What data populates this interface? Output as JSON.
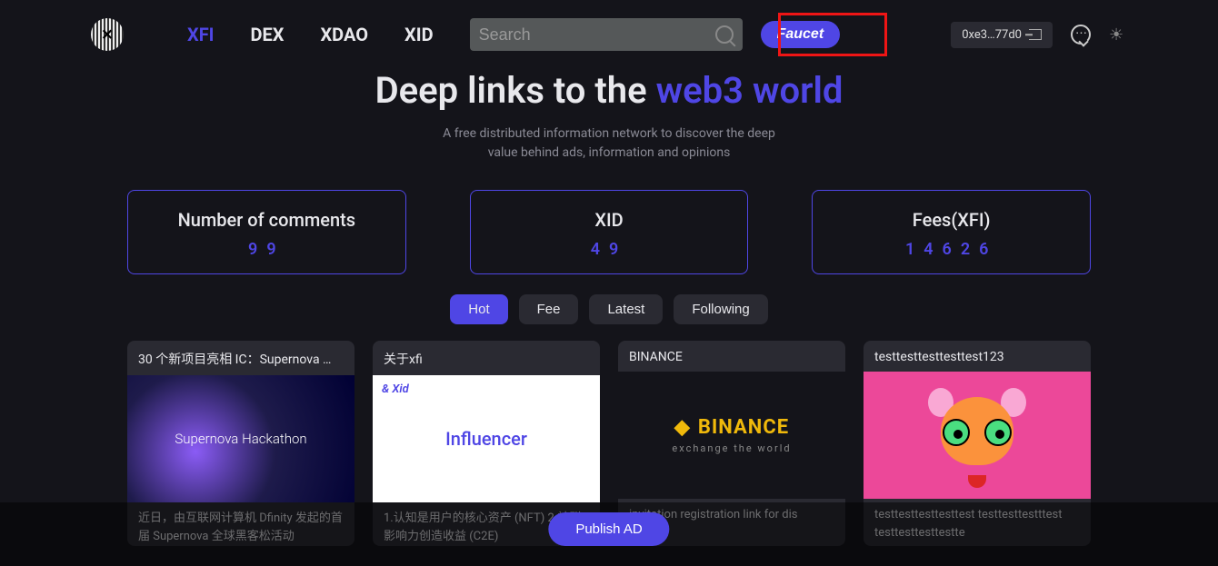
{
  "nav": {
    "items": [
      "XFI",
      "DEX",
      "XDAO",
      "XID"
    ],
    "active": 0
  },
  "search": {
    "placeholder": "Search"
  },
  "faucet_label": "Faucet",
  "wallet_address": "0xe3…77d0",
  "hero": {
    "title_pre": "Deep links to the ",
    "title_accent": "web3 world",
    "subtitle_l1": "A free distributed information network to discover the deep",
    "subtitle_l2": "value behind ads, information and opinions"
  },
  "stats": [
    {
      "label": "Number of comments",
      "value": "99"
    },
    {
      "label": "XID",
      "value": "49"
    },
    {
      "label": "Fees(XFI)",
      "value": "14626"
    }
  ],
  "filters": [
    "Hot",
    "Fee",
    "Latest",
    "Following"
  ],
  "filter_active": 0,
  "cards": [
    {
      "title": "30 个新项目亮相 IC：Supernova …",
      "img_text_main": "Supernova",
      "img_text_sub": "Hackathon",
      "desc": "近日，由互联网计算机 Dfinity 发起的首届 Supernova 全球黑客松活动"
    },
    {
      "title": "关于xfi",
      "img_top": "& Xid",
      "img_text": "Influencer",
      "desc": "1.认知是用户的核心资产 (NFT)   2.社群影响力创造收益 (C2E)"
    },
    {
      "title": "BINANCE",
      "img_logo": "BINANCE",
      "img_sub": "exchange the world",
      "desc": "invitation registration link for dis"
    },
    {
      "title": "testtesttesttesttest123",
      "desc": "testtesttesttesttest testtesttestttest testtesttesttestte"
    }
  ],
  "publish_label": "Publish AD"
}
